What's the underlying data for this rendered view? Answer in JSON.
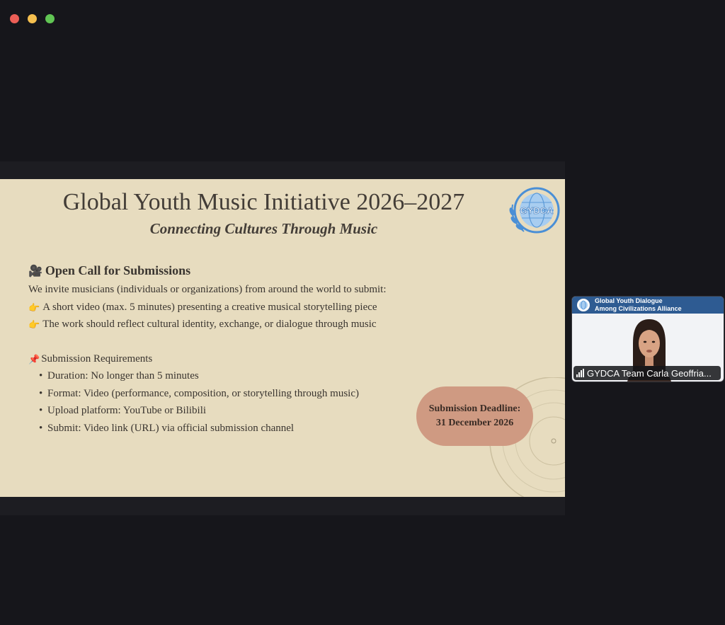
{
  "window": {
    "controls": [
      "close",
      "minimize",
      "zoom"
    ]
  },
  "slide": {
    "title": "Global Youth Music Initiative 2026–2027",
    "subtitle": "Connecting Cultures Through Music",
    "logo_text": "GYDCA",
    "open_call": {
      "icon": "video-camera-icon",
      "heading": "Open Call for Submissions",
      "intro": "We invite musicians (individuals or organizations) from around the world to submit:",
      "points": [
        "A short video (max. 5 minutes) presenting a creative musical storytelling piece",
        "The work should reflect cultural identity, exchange, or dialogue through music"
      ]
    },
    "requirements": {
      "icon": "pushpin-icon",
      "heading": "Submission Requirements",
      "items": [
        "Duration: No longer than 5 minutes",
        "Format: Video (performance, composition, or storytelling through music)",
        "Upload platform: YouTube or Bilibili",
        "Submit: Video link (URL) via official submission channel"
      ]
    },
    "deadline": {
      "label": "Submission Deadline:",
      "date": "31 December 2026"
    }
  },
  "participant": {
    "org_line1": "Global Youth Dialogue",
    "org_line2": "Among Civilizations Alliance",
    "name": "GYDCA Team Carla Geoffria..."
  },
  "colors": {
    "app_bg": "#16161b",
    "slide_bg": "#e7dcbf",
    "deadline_bg": "#cf9a82",
    "logo_blue": "#4a8fd6",
    "tile_header": "#2e5b92"
  }
}
